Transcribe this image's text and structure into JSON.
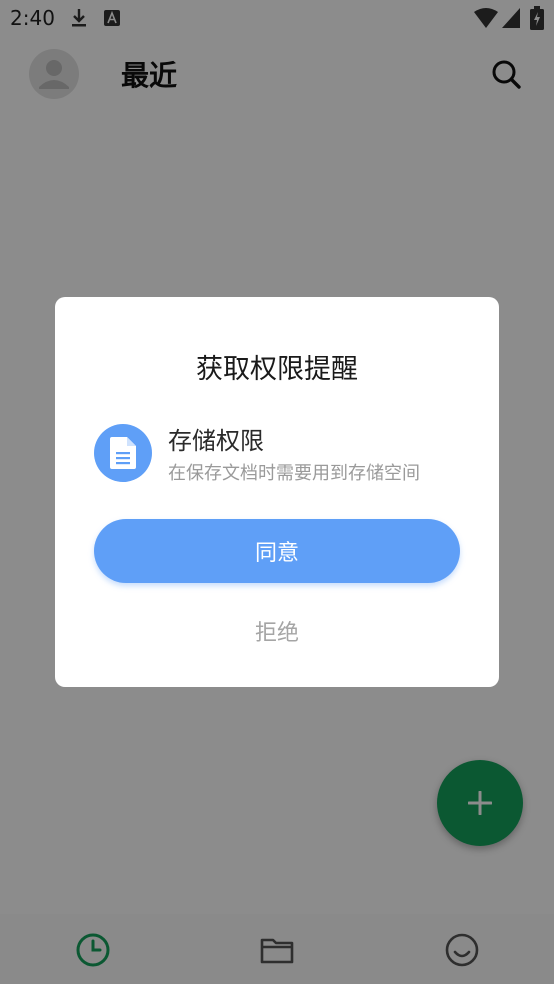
{
  "status_bar": {
    "time": "2:40",
    "icons": [
      "download-icon",
      "a-notification-icon",
      "wifi-icon",
      "signal-icon",
      "battery-charging-icon"
    ]
  },
  "header": {
    "title": "最近",
    "avatar_icon": "person-icon",
    "search_icon": "search-icon"
  },
  "dialog": {
    "title": "获取权限提醒",
    "permission": {
      "icon": "document-icon",
      "name": "存储权限",
      "description": "在保存文档时需要用到存储空间"
    },
    "agree_label": "同意",
    "refuse_label": "拒绝"
  },
  "fab": {
    "icon": "plus-icon"
  },
  "bottom_nav": {
    "items": [
      {
        "icon": "clock-icon",
        "active": true
      },
      {
        "icon": "folder-icon",
        "active": false
      },
      {
        "icon": "smiley-icon",
        "active": false
      }
    ]
  },
  "colors": {
    "accent_blue": "#5f9ff7",
    "fab_green": "#14a05c",
    "active_nav_green": "#14a05c"
  }
}
